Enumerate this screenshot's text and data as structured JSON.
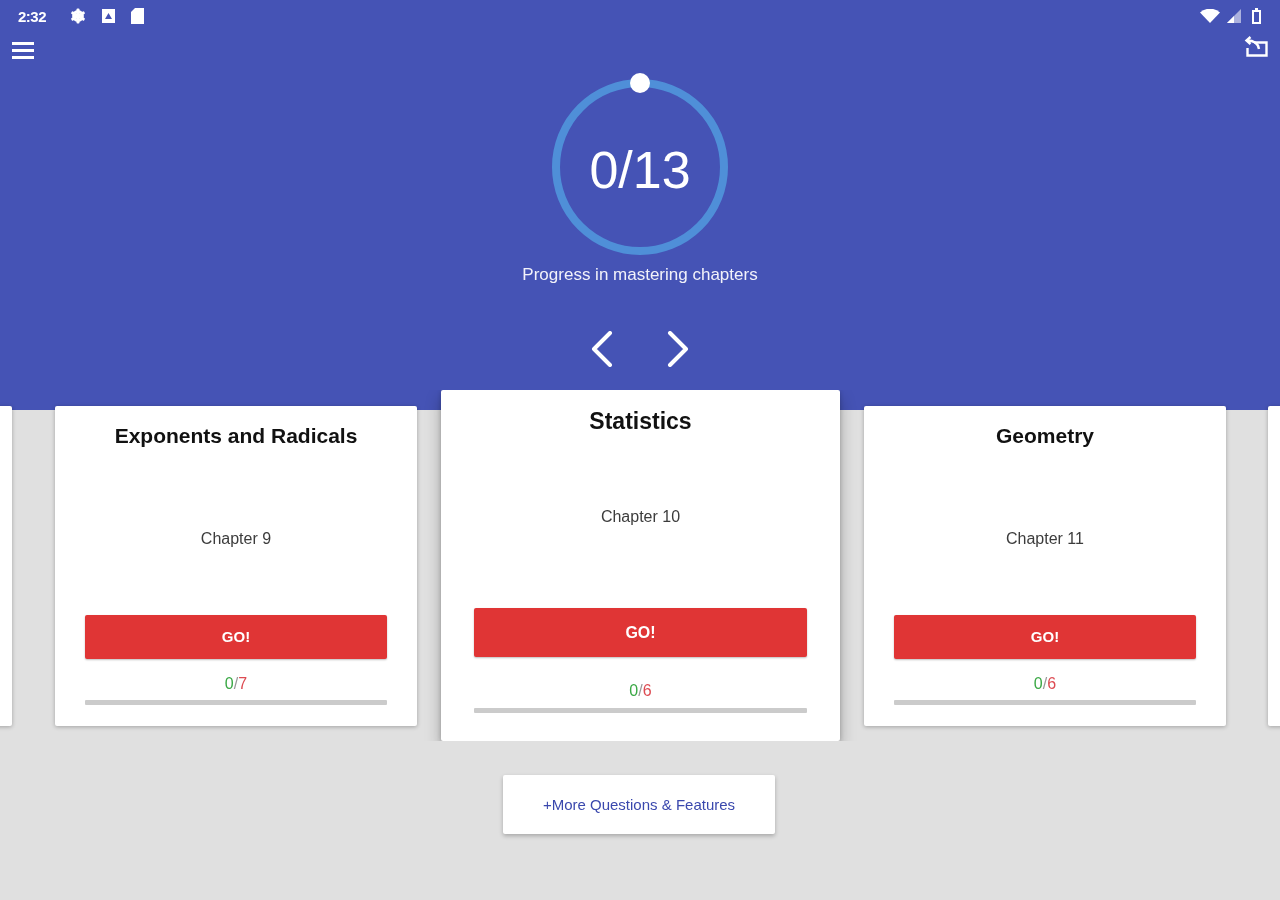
{
  "status_bar": {
    "time": "2:32"
  },
  "progress": {
    "value": "0/13",
    "caption": "Progress in mastering chapters"
  },
  "chapters": [
    {
      "title": "Exponents and Radicals",
      "subtitle": "Chapter 9",
      "button": "GO!",
      "score": {
        "done": "0",
        "separator": "/",
        "total": "7"
      },
      "level": 0,
      "selected": false
    },
    {
      "title": "Statistics",
      "subtitle": "Chapter 10",
      "button": "GO!",
      "score": {
        "done": "0",
        "separator": "/",
        "total": "6"
      },
      "level": 0,
      "selected": true
    },
    {
      "title": "Geometry",
      "subtitle": "Chapter 11",
      "button": "GO!",
      "score": {
        "done": "0",
        "separator": "/",
        "total": "6"
      },
      "level": 0,
      "selected": false
    }
  ],
  "more_button": {
    "label": "+More Questions & Features"
  }
}
